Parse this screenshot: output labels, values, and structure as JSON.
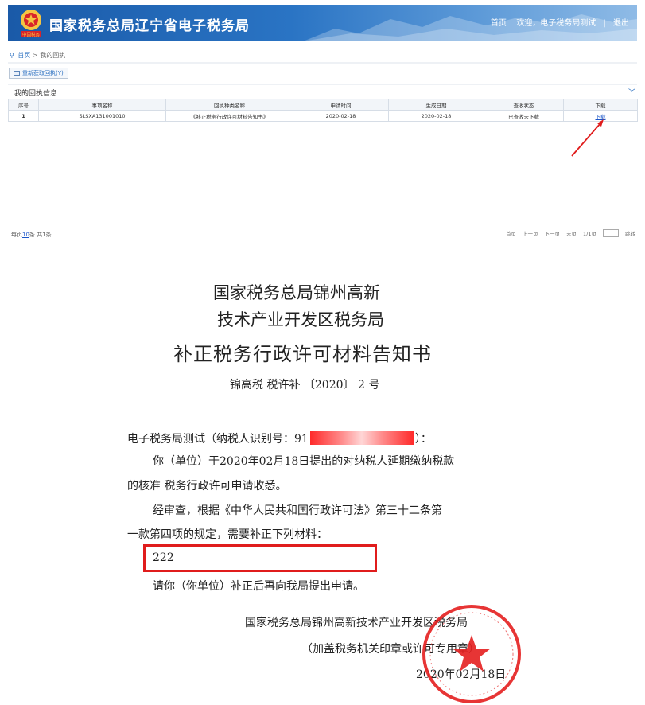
{
  "header": {
    "title": "国家税务总局辽宁省电子税务局",
    "emblem_text": "中国税务",
    "nav": {
      "home": "首页",
      "welcome": "欢迎，电子税务局测试",
      "sep": "|",
      "logout": "退出"
    }
  },
  "breadcrumb": {
    "home": "首页",
    "sep": ">",
    "current": "我的回执"
  },
  "toolbar": {
    "refresh_label": "重新获取回执(Y)"
  },
  "panel": {
    "title": "我的回执信息",
    "columns": [
      "序号",
      "事项名称",
      "回执种类名称",
      "申请时间",
      "生成日期",
      "查收状态",
      "下载"
    ],
    "rows": [
      [
        "1",
        "SLSXA131001010",
        "《补正税务行政许可材料告知书》",
        "2020-02-18",
        "2020-02-18",
        "已查收未下载",
        "下载"
      ]
    ]
  },
  "pager": {
    "left": {
      "prefix": "每页",
      "page_size": "10",
      "suffix": "条 共1条"
    },
    "first": "首页",
    "prev": "上一页",
    "next": "下一页",
    "last": "末页",
    "page_info": "1/1页",
    "go": "跳转"
  },
  "notice": {
    "org_line1": "国家税务总局锦州高新",
    "org_line2": "技术产业开发区税务局",
    "title": "补正税务行政许可材料告知书",
    "doc_no": "锦高税  税许补 〔2020〕 2 号",
    "addressee_prefix": "电子税务局测试（纳税人识别号：91",
    "addressee_suffix": "）：",
    "para1_line1": "你（单位）于2020年02月18日提出的对纳税人延期缴纳税款",
    "para1_line2": "的核准 税务行政许可申请收悉。",
    "para2_line1": "经审查，根据《中华人民共和国行政许可法》第三十二条第",
    "para2_line2": "一款第四项的规定，需要补正下列材料：",
    "material": "222",
    "para3": "请你（你单位）补正后再向我局提出申请。",
    "sign_org": "国家税务总局锦州高新技术产业开发区税务局",
    "sign_note": "（加盖税务机关印章或许可专用章）",
    "date": "2020年02月18日"
  },
  "colors": {
    "header_blue": "#1a5aa8",
    "link_blue": "#1a55c8",
    "annotation_red": "#e01c1c",
    "seal_red": "#e52020"
  }
}
